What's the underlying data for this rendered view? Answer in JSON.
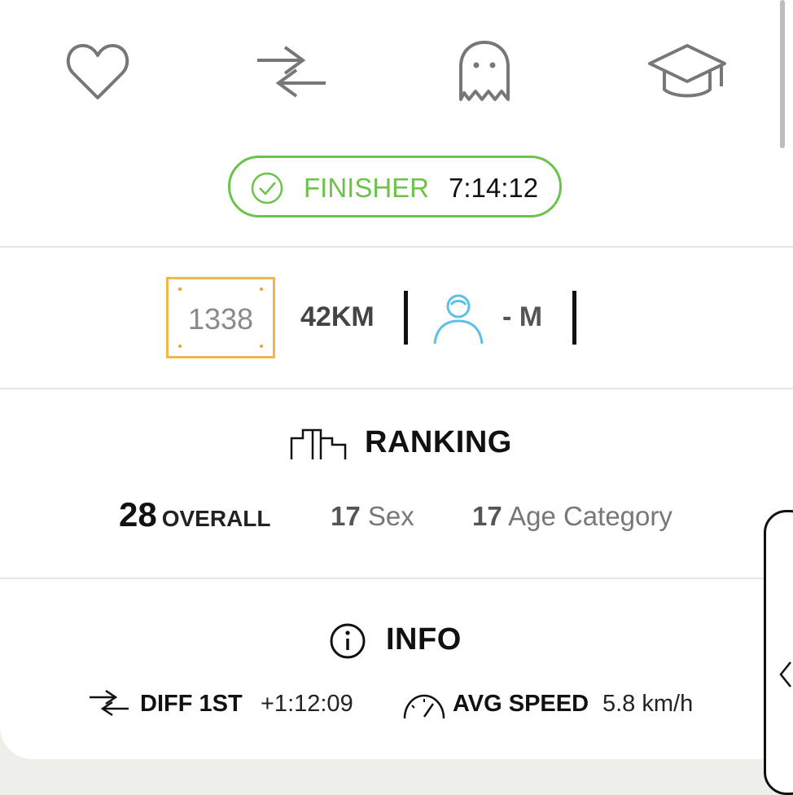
{
  "status": {
    "label": "FINISHER",
    "time": "7:14:12",
    "color": "#6cc24a"
  },
  "icons": {
    "top_row": [
      "heart-icon",
      "swap-arrows-icon",
      "ghost-icon",
      "graduation-cap-icon"
    ]
  },
  "runner": {
    "bib": "1338",
    "distance": "42KM",
    "gender": "- M"
  },
  "ranking": {
    "title": "RANKING",
    "overall_value": "28",
    "overall_label": "OVERALL",
    "sex_value": "17",
    "sex_label": "Sex",
    "age_value": "17",
    "age_label": "Age Category"
  },
  "info": {
    "title": "INFO",
    "diff_label": "DIFF 1ST",
    "diff_value": "+1:12:09",
    "speed_label": "AVG SPEED",
    "speed_value": "5.8 km/h"
  },
  "colors": {
    "accent_green": "#6cc24a",
    "bib_orange": "#f0b84a",
    "person_blue": "#5bc0e8"
  }
}
